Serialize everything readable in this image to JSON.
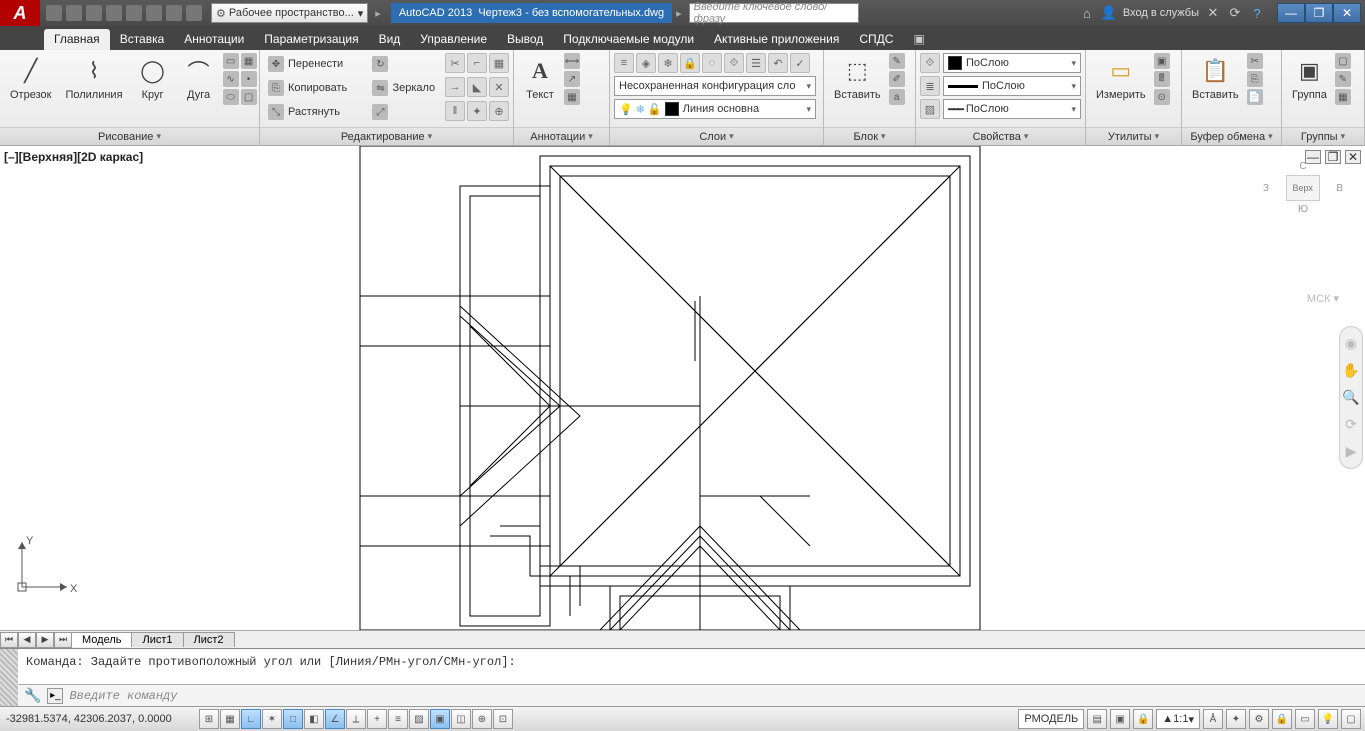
{
  "titlebar": {
    "workspace": "Рабочее пространство...",
    "app_name": "AutoCAD 2013",
    "file_name": "Чертеж3 - без вспомогательных.dwg",
    "search_placeholder": "Введите ключевое слово/фразу",
    "login": "Вход в службы"
  },
  "tabs": [
    "Главная",
    "Вставка",
    "Аннотации",
    "Параметризация",
    "Вид",
    "Управление",
    "Вывод",
    "Подключаемые модули",
    "Активные приложения",
    "СПДС"
  ],
  "panels": {
    "draw": {
      "title": "Рисование",
      "line": "Отрезок",
      "pline": "Полилиния",
      "circle": "Круг",
      "arc": "Дуга"
    },
    "edit": {
      "title": "Редактирование",
      "move": "Перенести",
      "copy": "Копировать",
      "stretch": "Растянуть",
      "mirror": "Зеркало"
    },
    "annot": {
      "title": "Аннотации",
      "text": "Текст"
    },
    "layers": {
      "title": "Слои",
      "config": "Несохраненная конфигурация сло",
      "layer": "Линия основна"
    },
    "block": {
      "title": "Блок",
      "insert": "Вставить"
    },
    "props": {
      "title": "Свойства",
      "color": "ПоСлою",
      "ltype": "ПоСлою",
      "lweight": "ПоСлою"
    },
    "utils": {
      "title": "Утилиты",
      "measure": "Измерить"
    },
    "clip": {
      "title": "Буфер обмена",
      "paste": "Вставить"
    },
    "group": {
      "title": "Группы",
      "group": "Группа"
    }
  },
  "viewport": {
    "label": "[–][Верхняя][2D каркас]"
  },
  "viewcube": {
    "top": "Верх",
    "s": "С",
    "e": "В",
    "w": "З",
    "south": "Ю",
    "cs": "МСК"
  },
  "layout": {
    "model": "Модель",
    "sheet1": "Лист1",
    "sheet2": "Лист2"
  },
  "command": {
    "history": "Команда: Задайте противоположный угол или [Линия/РМн-угол/СМн-угол]:",
    "prompt_placeholder": "Введите команду"
  },
  "status": {
    "coords": "-32981.5374, 42306.2037, 0.0000",
    "space": "РМОДЕЛЬ",
    "scale": "1:1"
  }
}
